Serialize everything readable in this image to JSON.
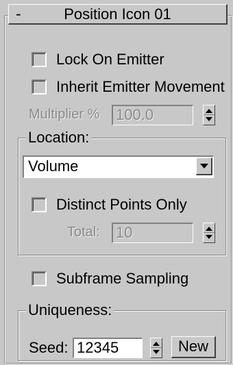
{
  "rollout": {
    "collapse_symbol": "-",
    "title": "Position Icon 01"
  },
  "lock_on_emitter": {
    "label": "Lock On Emitter",
    "checked": false
  },
  "inherit_movement": {
    "label": "Inherit Emitter Movement",
    "checked": false
  },
  "multiplier": {
    "label": "Multiplier %",
    "value": "100.0",
    "enabled": false
  },
  "location": {
    "group_title": "Location:",
    "selected": "Volume",
    "distinct_points": {
      "label": "Distinct Points Only",
      "checked": false
    },
    "total": {
      "label": "Total:",
      "value": "10",
      "enabled": false
    }
  },
  "subframe_sampling": {
    "label": "Subframe Sampling",
    "checked": false
  },
  "uniqueness": {
    "group_title": "Uniqueness:",
    "seed_label": "Seed:",
    "seed_value": "12345",
    "new_button": "New"
  }
}
